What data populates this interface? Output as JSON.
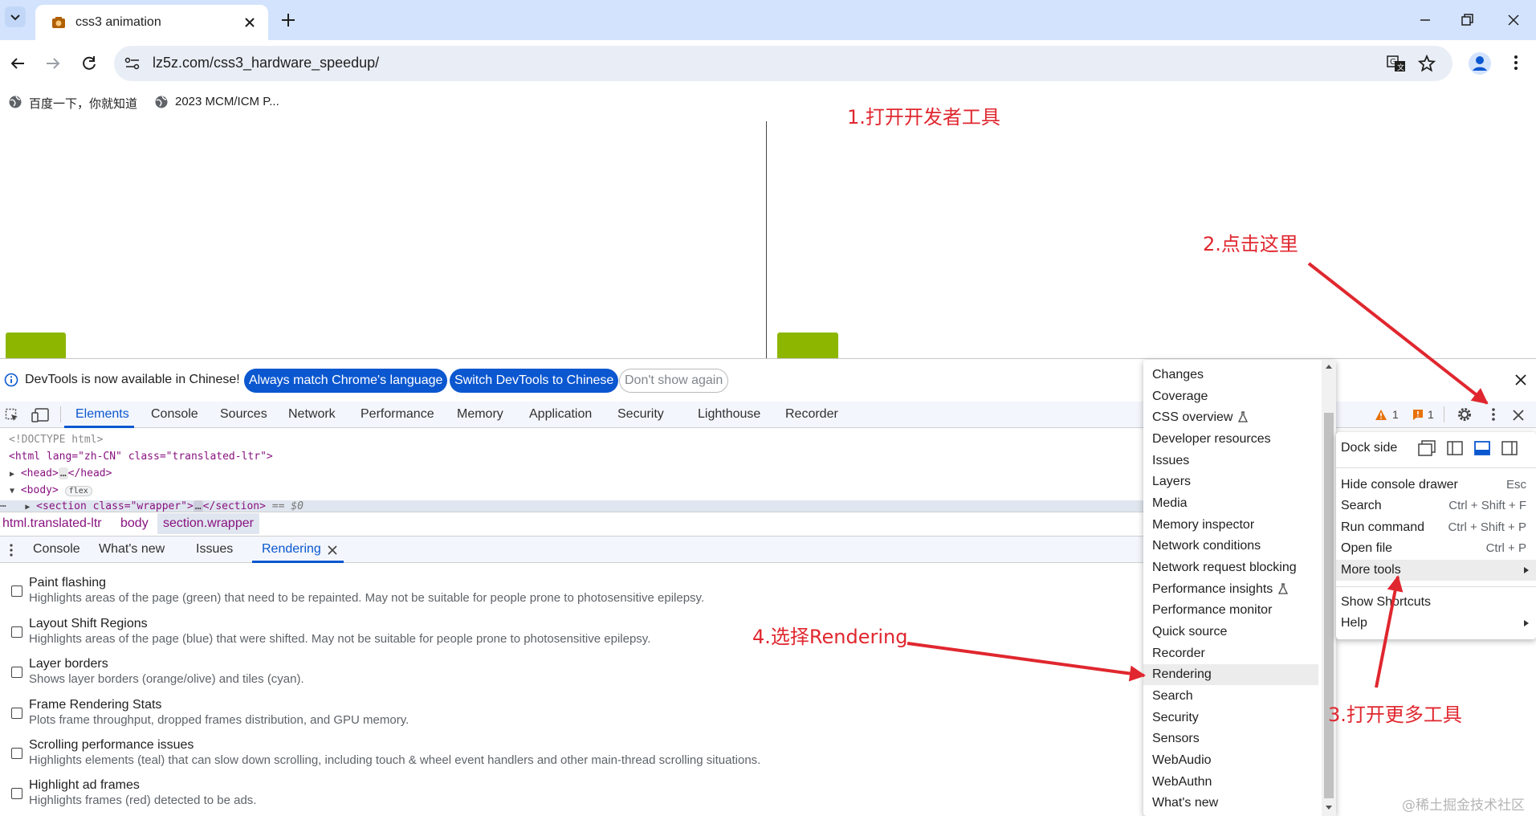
{
  "browser": {
    "tab_title": "css3 animation",
    "url": "lz5z.com/css3_hardware_speedup/",
    "bookmarks": [
      "百度一下，你就知道",
      "2023 MCM/ICM P..."
    ]
  },
  "infobar": {
    "message": "DevTools is now available in Chinese!",
    "btn_match": "Always match Chrome's language",
    "btn_switch": "Switch DevTools to Chinese",
    "btn_dont_show": "Don't show again"
  },
  "devtools": {
    "tabs": [
      "Elements",
      "Console",
      "Sources",
      "Network",
      "Performance",
      "Memory",
      "Application",
      "Security",
      "Lighthouse",
      "Recorder"
    ],
    "active_tab": "Elements",
    "warning_count": "1",
    "issue_count": "1",
    "dom_lines": [
      "<!DOCTYPE html>",
      "<html lang=\"zh-CN\" class=\"translated-ltr\">",
      "<head>",
      "</head>",
      "<body>",
      "flex",
      "<section class=\"wrapper\">",
      "</section>",
      "== $0"
    ],
    "breadcrumbs": [
      "html.translated-ltr",
      "body",
      "section.wrapper"
    ],
    "drawer_tabs": [
      "Console",
      "What's new",
      "Issues",
      "Rendering"
    ],
    "active_drawer_tab": "Rendering",
    "rendering_options": [
      {
        "title": "Paint flashing",
        "desc": "Highlights areas of the page (green) that need to be repainted. May not be suitable for people prone to photosensitive epilepsy."
      },
      {
        "title": "Layout Shift Regions",
        "desc": "Highlights areas of the page (blue) that were shifted. May not be suitable for people prone to photosensitive epilepsy."
      },
      {
        "title": "Layer borders",
        "desc": "Shows layer borders (orange/olive) and tiles (cyan)."
      },
      {
        "title": "Frame Rendering Stats",
        "desc": "Plots frame throughput, dropped frames distribution, and GPU memory."
      },
      {
        "title": "Scrolling performance issues",
        "desc": "Highlights elements (teal) that can slow down scrolling, including touch & wheel event handlers and other main-thread scrolling situations."
      },
      {
        "title": "Highlight ad frames",
        "desc": "Highlights frames (red) detected to be ads."
      }
    ]
  },
  "more_tools_menu": [
    "Changes",
    "Coverage",
    "CSS overview",
    "Developer resources",
    "Issues",
    "Layers",
    "Media",
    "Memory inspector",
    "Network conditions",
    "Network request blocking",
    "Performance insights",
    "Performance monitor",
    "Quick source",
    "Recorder",
    "Rendering",
    "Search",
    "Security",
    "Sensors",
    "WebAudio",
    "WebAuthn",
    "What's new"
  ],
  "highlighted_tool": "Rendering",
  "main_menu": {
    "dock_side": "Dock side",
    "items": [
      {
        "label": "Hide console drawer",
        "shortcut": "Esc"
      },
      {
        "label": "Search",
        "shortcut": "Ctrl + Shift + F"
      },
      {
        "label": "Run command",
        "shortcut": "Ctrl + Shift + P"
      },
      {
        "label": "Open file",
        "shortcut": "Ctrl + P"
      },
      {
        "label": "More tools",
        "shortcut": ""
      },
      {
        "label": "Show Shortcuts",
        "shortcut": ""
      },
      {
        "label": "Help",
        "shortcut": ""
      }
    ]
  },
  "annotations": [
    "1.打开开发者工具",
    "2.点击这里",
    "3.打开更多工具",
    "4.选择Rendering"
  ],
  "watermark": "@稀土掘金技术社区",
  "colors": {
    "accent": "#0b57d0",
    "annotation": "#e0272f",
    "green_box": "#8db600"
  }
}
